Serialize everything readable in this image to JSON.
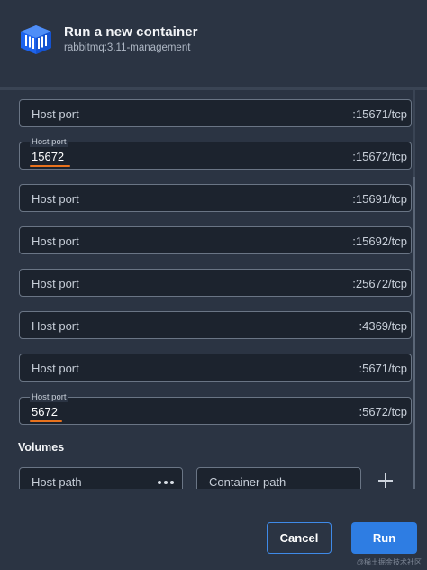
{
  "header": {
    "title": "Run a new container",
    "subtitle": "rabbitmq:3.11-management",
    "icon": "docker-container-icon"
  },
  "ports": [
    {
      "label": "Host port",
      "value": "",
      "suffix": ":15671/tcp"
    },
    {
      "label": "Host port",
      "value": "15672",
      "suffix": ":15672/tcp"
    },
    {
      "label": "Host port",
      "value": "",
      "suffix": ":15691/tcp"
    },
    {
      "label": "Host port",
      "value": "",
      "suffix": ":15692/tcp"
    },
    {
      "label": "Host port",
      "value": "",
      "suffix": ":25672/tcp"
    },
    {
      "label": "Host port",
      "value": "",
      "suffix": ":4369/tcp"
    },
    {
      "label": "Host port",
      "value": "",
      "suffix": ":5671/tcp"
    },
    {
      "label": "Host port",
      "value": "5672",
      "suffix": ":5672/tcp"
    }
  ],
  "volumes": {
    "heading": "Volumes",
    "host_path_placeholder": "Host path",
    "container_path_placeholder": "Container path",
    "browse_icon": "more-dots-icon",
    "add_icon": "plus-icon"
  },
  "footer": {
    "cancel_label": "Cancel",
    "run_label": "Run"
  },
  "watermark": "@稀土掘金技术社区",
  "colors": {
    "background": "#2b3443",
    "field_background": "#1c232e",
    "accent_blue": "#2e7de3",
    "focus_underline": "#e9721d"
  }
}
